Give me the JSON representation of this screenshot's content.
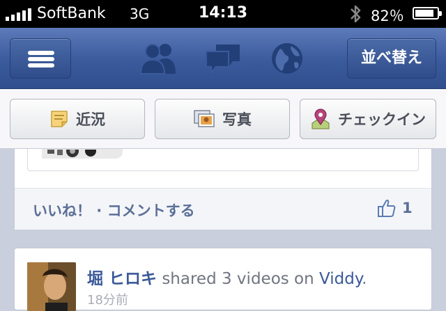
{
  "status_bar": {
    "carrier": "SoftBank",
    "network": "3G",
    "time": "14:13",
    "battery": "82％",
    "battery_level": 0.82,
    "signal_bars": 5,
    "icons": [
      "signal-icon",
      "bluetooth-icon",
      "battery-icon"
    ]
  },
  "nav_bar": {
    "menu_icon": "hamburger-menu-icon",
    "icons": [
      "friend-requests-icon",
      "messages-icon",
      "notifications-globe-icon"
    ],
    "sort_label": "並べ替え"
  },
  "composer": {
    "status_label": "近況",
    "photo_label": "写真",
    "checkin_label": "チェックイン"
  },
  "feed": {
    "post1": {
      "actions": "いいね！ · コメントする",
      "like_count": "1"
    },
    "post2": {
      "author": "堀 ヒロキ",
      "action_text": " shared 3 videos on ",
      "app_link": "Viddy",
      "period": ".",
      "time": "18分前"
    }
  },
  "colors": {
    "facebook_blue": "#3b5998",
    "nav_bar": "#3a5a9c",
    "background": "#c9cfdc"
  }
}
